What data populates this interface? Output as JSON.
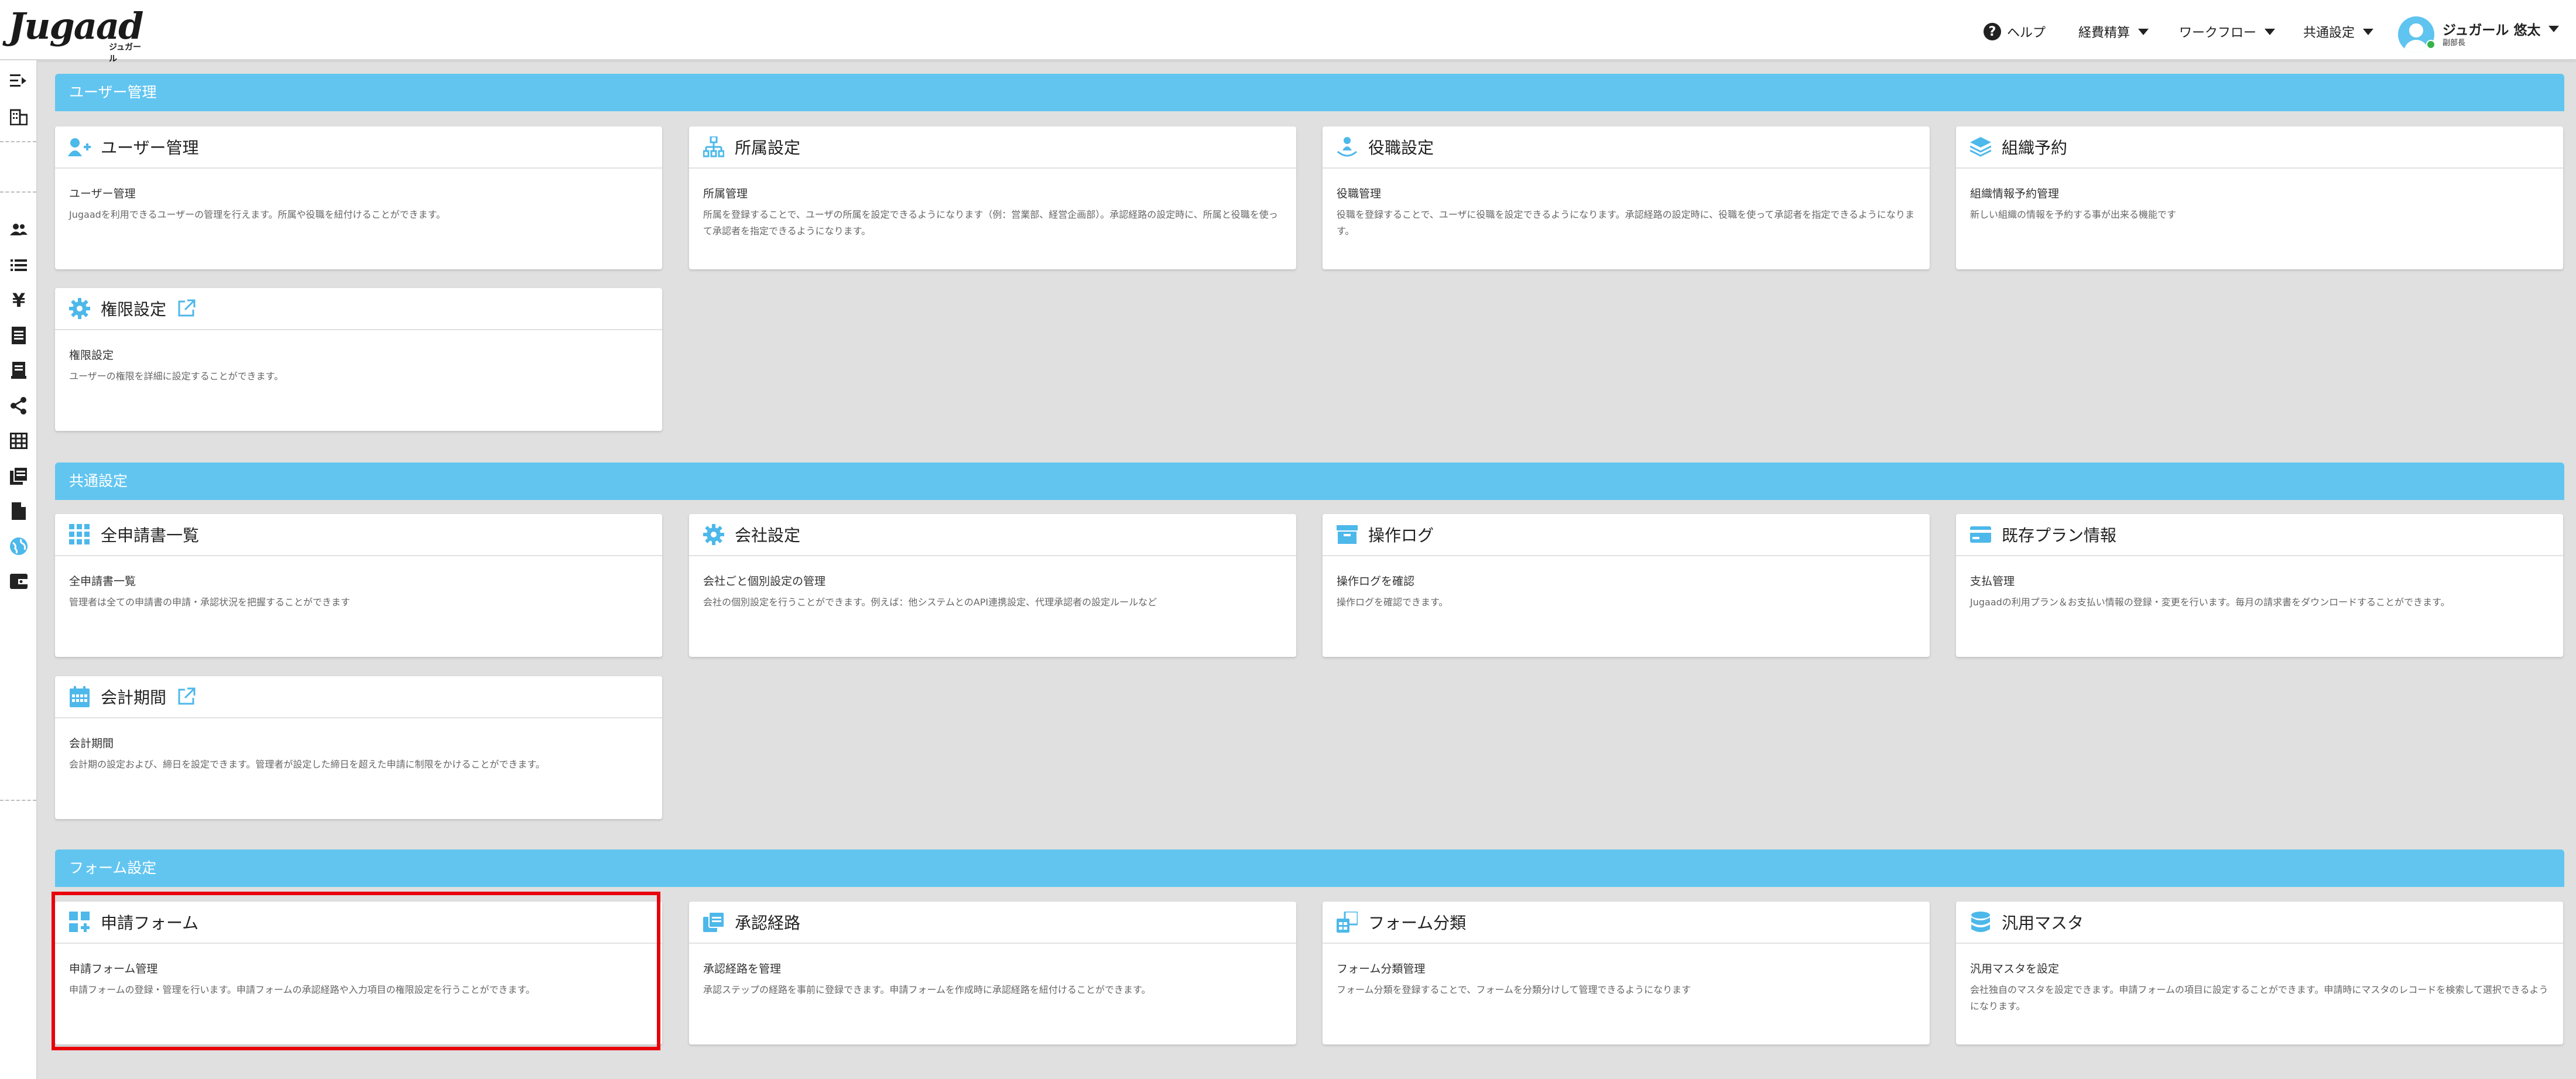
{
  "header": {
    "logo_text": "Jugaad",
    "logo_sub": "ジュガール",
    "nav": {
      "help": "ヘルプ",
      "expense": "経費精算",
      "workflow": "ワークフロー",
      "common": "共通設定"
    },
    "user": {
      "name": "ジュガール 悠太",
      "role": "副部長"
    }
  },
  "sidebar": {
    "icons": [
      "expand-menu-icon",
      "building-icon",
      "users-icon",
      "list-icon",
      "yen-icon",
      "document-icon",
      "receipt-icon",
      "share-icon",
      "table-icon",
      "copy-icon",
      "file-icon",
      "globe-icon",
      "wallet-icon"
    ]
  },
  "sections": [
    {
      "title": "ユーザー管理",
      "cards": [
        {
          "title": "ユーザー管理",
          "sub": "ユーザー管理",
          "desc": "Jugaadを利用できるユーザーの管理を行えます。所属や役職を紐付けることができます。",
          "icon": "user-add-icon"
        },
        {
          "title": "所属設定",
          "sub": "所属管理",
          "desc": "所属を登録することで、ユーザの所属を設定できるようになります（例：営業部、経営企画部）。承認経路の設定時に、所属と役職を使って承認者を指定できるようになります。",
          "icon": "org-tree-icon"
        },
        {
          "title": "役職設定",
          "sub": "役職管理",
          "desc": "役職を登録することで、ユーザに役職を設定できるようになります。承認経路の設定時に、役職を使って承認者を指定できるようになります。",
          "icon": "position-icon"
        },
        {
          "title": "組織予約",
          "sub": "組織情報予約管理",
          "desc": "新しい組織の情報を予約する事が出来る機能です",
          "icon": "layers-icon"
        },
        {
          "title": "権限設定",
          "sub": "権限設定",
          "desc": "ユーザーの権限を詳細に設定することができます。",
          "icon": "gear-icon"
        }
      ]
    },
    {
      "title": "共通設定",
      "cards": [
        {
          "title": "全申請書一覧",
          "sub": "全申請書一覧",
          "desc": "管理者は全ての申請書の申請・承認状況を把握することができます",
          "icon": "grid-icon"
        },
        {
          "title": "会社設定",
          "sub": "会社ごと個別設定の管理",
          "desc": "会社の個別設定を行うことができます。例えば：他システムとのAPI連携設定、代理承認者の設定ルールなど",
          "icon": "gear-icon"
        },
        {
          "title": "操作ログ",
          "sub": "操作ログを確認",
          "desc": "操作ログを確認できます。",
          "icon": "archive-icon"
        },
        {
          "title": "既存プラン情報",
          "sub": "支払管理",
          "desc": "Jugaadの利用プラン＆お支払い情報の登録・変更を行います。毎月の請求書をダウンロードすることができます。",
          "icon": "card-icon"
        },
        {
          "title": "会計期間",
          "sub": "会計期間",
          "desc": "会計期の設定および、締日を設定できます。管理者が設定した締日を超えた申請に制限をかけることができます。",
          "icon": "calendar-icon"
        }
      ]
    },
    {
      "title": "フォーム設定",
      "cards": [
        {
          "title": "申請フォーム",
          "sub": "申請フォーム管理",
          "desc": "申請フォームの登録・管理を行います。申請フォームの承認経路や入力項目の権限設定を行うことができます。",
          "icon": "form-add-icon"
        },
        {
          "title": "承認経路",
          "sub": "承認経路を管理",
          "desc": "承認ステップの経路を事前に登録できます。申請フォームを作成時に承認経路を紐付けることができます。",
          "icon": "route-icon"
        },
        {
          "title": "フォーム分類",
          "sub": "フォーム分類管理",
          "desc": "フォーム分類を登録することで、フォームを分類分けして管理できるようになります",
          "icon": "category-icon"
        },
        {
          "title": "汎用マスタ",
          "sub": "汎用マスタを設定",
          "desc": "会社独自のマスタを設定できます。申請フォームの項目に設定することができます。申請時にマスタのレコードを検索して選択できるようになります。",
          "icon": "database-icon"
        }
      ]
    }
  ],
  "colors": {
    "accent": "#62c5f0",
    "icon": "#4db8ea",
    "highlight": "#e8000b"
  }
}
